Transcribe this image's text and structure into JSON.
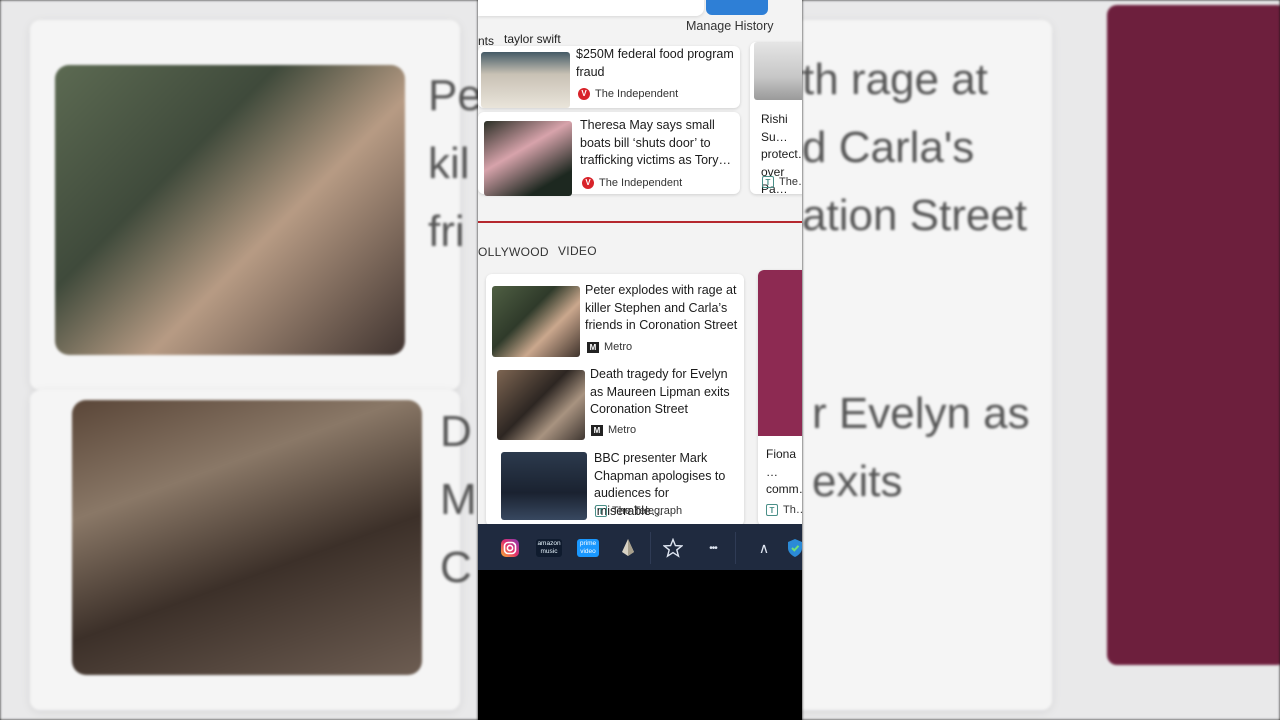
{
  "history": {
    "items": [
      "nts",
      "taylor swift"
    ],
    "manage_label": "Manage History"
  },
  "top_cards": [
    {
      "title": "$250M federal food program fraud",
      "source": "The Independent"
    },
    {
      "title": "Theresa May says small boats bill ‘shuts door’ to trafficking victims as Tory…",
      "source": "The Independent"
    }
  ],
  "top_right_card": {
    "title": "Rishi Su… protect… over Pa…",
    "source": "The…"
  },
  "tabs": [
    "OLLYWOOD",
    "VIDEO"
  ],
  "cards": [
    {
      "title": "Peter explodes with rage at killer Stephen and Carla’s friends in Coronation Street",
      "source": "Metro"
    },
    {
      "title": "Death tragedy for Evelyn as Maureen Lipman exits Coronation Street",
      "source": "Metro"
    },
    {
      "title": "BBC presenter Mark Chapman apologises to audiences for ‘miserable…",
      "source": "The Telegraph"
    }
  ],
  "right_card": {
    "title": "Fiona … comm…",
    "source": "Th…"
  },
  "taskbar": {
    "amazon_music": "amazon music",
    "prime_video": "prime video",
    "more": "•••",
    "chevron": "∧"
  },
  "mirror_left": {
    "letters": [
      "Pe",
      "kil",
      "fri"
    ],
    "letters2": [
      "D",
      "M",
      "C"
    ]
  },
  "mirror_right": {
    "lines": [
      "th rage at",
      "d Carla's",
      "ation Street"
    ],
    "lines2": [
      "r Evelyn as",
      "exits"
    ]
  },
  "colors": {
    "accent_red": "#b5282e",
    "search_blue": "#2e7fd6",
    "taskbar_bg": "#1f2a3f"
  }
}
